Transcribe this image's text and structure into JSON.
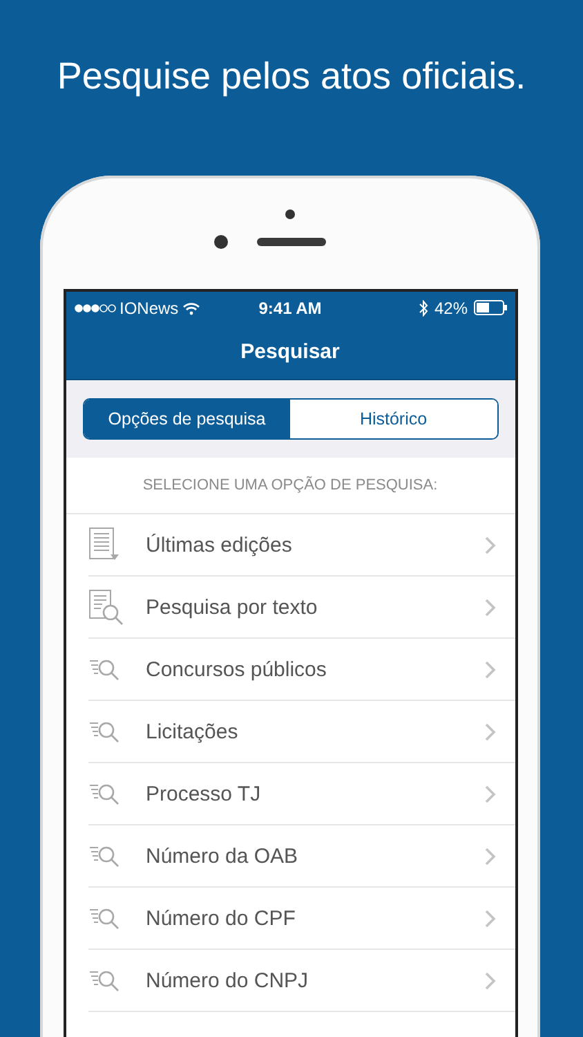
{
  "headline": "Pesquise pelos atos oficiais.",
  "status_bar": {
    "carrier": "IONews",
    "time": "9:41 AM",
    "battery": "42%"
  },
  "nav": {
    "title": "Pesquisar"
  },
  "segments": [
    {
      "label": "Opções de pesquisa",
      "selected": true
    },
    {
      "label": "Histórico",
      "selected": false
    }
  ],
  "section_header": "SELECIONE UMA OPÇÃO DE PESQUISA:",
  "options": [
    {
      "kind": "document-download",
      "label": "Últimas edições"
    },
    {
      "kind": "document-search",
      "label": "Pesquisa por texto"
    },
    {
      "kind": "list-search",
      "label": "Concursos públicos"
    },
    {
      "kind": "list-search",
      "label": "Licitações"
    },
    {
      "kind": "list-search",
      "label": "Processo TJ"
    },
    {
      "kind": "list-search",
      "label": "Número da OAB"
    },
    {
      "kind": "list-search",
      "label": "Número do CPF"
    },
    {
      "kind": "list-search",
      "label": "Número do CNPJ"
    }
  ]
}
